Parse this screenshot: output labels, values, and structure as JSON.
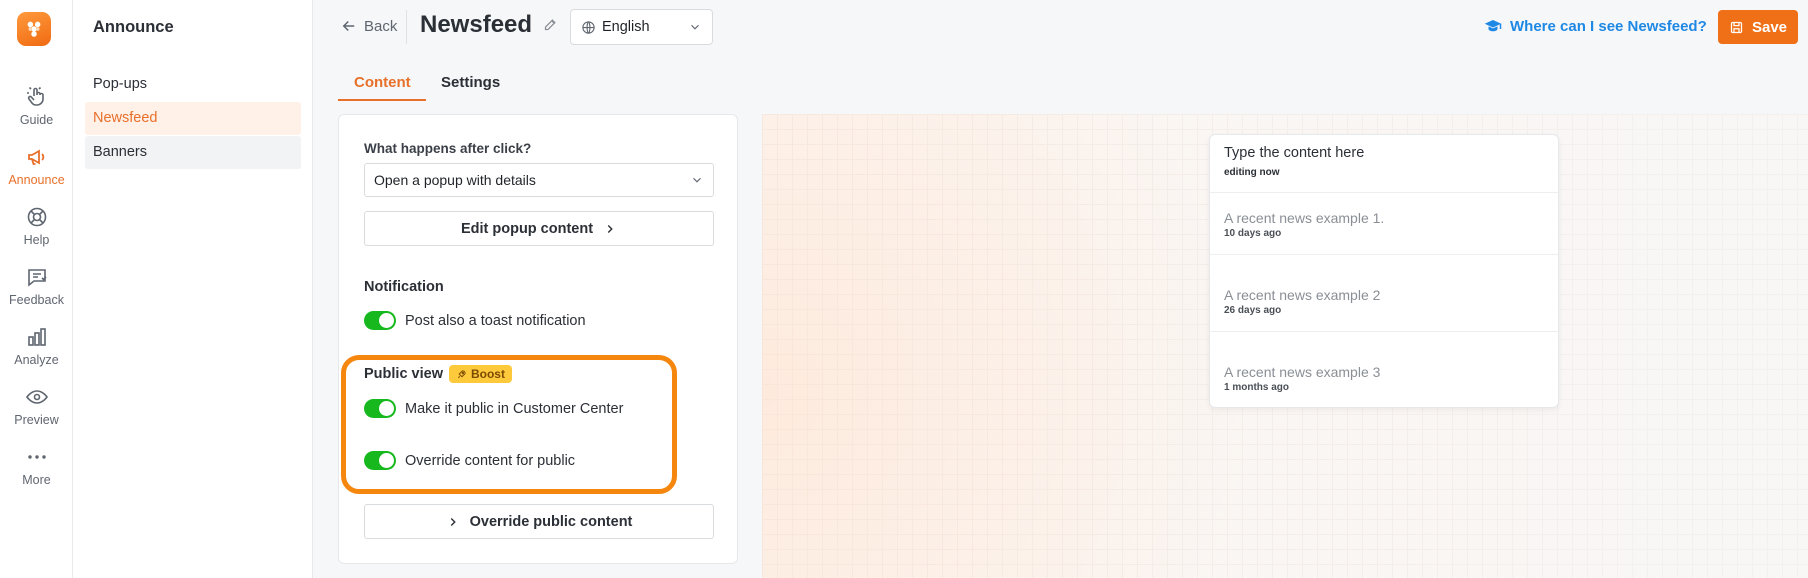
{
  "rail": {
    "items": [
      {
        "label": "Guide",
        "icon": "hand-pointer-icon"
      },
      {
        "label": "Announce",
        "icon": "megaphone-icon"
      },
      {
        "label": "Help",
        "icon": "lifebuoy-icon"
      },
      {
        "label": "Feedback",
        "icon": "feedback-icon"
      },
      {
        "label": "Analyze",
        "icon": "bar-chart-icon"
      },
      {
        "label": "Preview",
        "icon": "eye-icon"
      },
      {
        "label": "More",
        "icon": "more-dots-icon"
      }
    ]
  },
  "sidebar": {
    "title": "Announce",
    "items": [
      {
        "label": "Pop-ups"
      },
      {
        "label": "Newsfeed"
      },
      {
        "label": "Banners"
      }
    ]
  },
  "header": {
    "back_label": "Back",
    "title": "Newsfeed",
    "language": "English",
    "where_label": "Where can I see Newsfeed?",
    "save_label": "Save"
  },
  "tabs": [
    {
      "label": "Content"
    },
    {
      "label": "Settings"
    }
  ],
  "form": {
    "after_click_label": "What happens after click?",
    "after_click_value": "Open a popup with details",
    "edit_popup_label": "Edit popup content",
    "notification_heading": "Notification",
    "toast_label": "Post also a toast notification",
    "public_view_heading": "Public view",
    "boost_badge": "Boost",
    "make_public_label": "Make it public in Customer Center",
    "override_label": "Override content for public",
    "override_button_label": "Override public content"
  },
  "feed": {
    "editing_title": "Type the content here",
    "editing_status": "editing now",
    "items": [
      {
        "title": "A recent news example 1.",
        "time": "10 days ago"
      },
      {
        "title": "A recent news example 2",
        "time": "26 days ago"
      },
      {
        "title": "A recent news example 3",
        "time": "1 months ago"
      }
    ]
  },
  "colors": {
    "accent": "#f07018",
    "link": "#1e88e5",
    "toggle_on": "#16b81e",
    "badge": "#ffc93c"
  }
}
